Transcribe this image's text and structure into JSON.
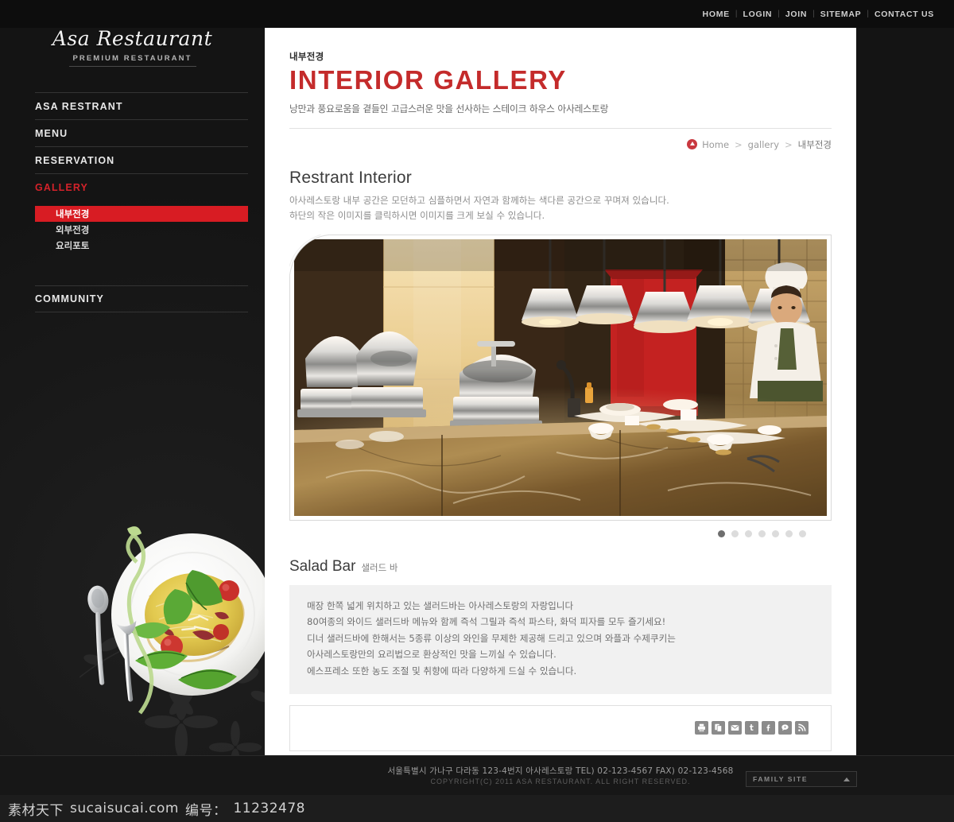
{
  "topnav": {
    "items": [
      {
        "label": "HOME"
      },
      {
        "label": "LOGIN"
      },
      {
        "label": "JOIN"
      },
      {
        "label": "SITEMAP"
      },
      {
        "label": "CONTACT US"
      }
    ],
    "separator": "|"
  },
  "logo": {
    "brand": "Asa Restaurant",
    "tagline": "PREMIUM  RESTAURANT"
  },
  "sidebar": {
    "items": [
      {
        "label": "ASA RESTRANT",
        "active": false
      },
      {
        "label": "MENU",
        "active": false
      },
      {
        "label": "RESERVATION",
        "active": false
      },
      {
        "label": "GALLERY",
        "active": true
      }
    ],
    "submenu": [
      {
        "label": "내부전경",
        "selected": true
      },
      {
        "label": "외부전경",
        "selected": false
      },
      {
        "label": "요리포토",
        "selected": false
      }
    ],
    "community": "COMMUNITY"
  },
  "page": {
    "eyebrow": "내부전경",
    "title": "INTERIOR GALLERY",
    "subtitle": "낭만과 풍요로움을 곁들인 고급스러운 맛을 선사하는 스테이크 하우스 아사레스토랑"
  },
  "breadcrumb": {
    "home": "Home",
    "sep1": ">",
    "section": "gallery",
    "sep2": ">",
    "current": "내부전경"
  },
  "section": {
    "heading": "Restrant Interior",
    "desc_line1": "아사레스토랑 내부 공간은 모던하고 심플하면서 자연과 함께하는 색다른 공간으로 꾸며져 있습니다.",
    "desc_line2": "하단의 작은 이미지를 클릭하시면 이미지를 크게 보실 수 있습니다."
  },
  "gallery": {
    "slide_count": 7,
    "active_slide": 1,
    "alt": "restaurant-interior-buffet-counter"
  },
  "salad": {
    "heading_en": "Salad Bar",
    "heading_ko": "샐러드 바",
    "lines": [
      "매장 한쪽 넓게 위치하고 있는 샐러드바는 아사레스토랑의 자랑입니다",
      "80여종의 와이드 샐러드바 메뉴와 함께 즉석 그릴과 즉석 파스타, 화덕 피자를 모두 즐기세요!",
      "디너 샐러드바에 한해서는 5종류 이상의 와인을 무제한 제공해 드리고 있으며 와플과 수제쿠키는",
      "아사레스토랑만의 요리법으로 환상적인 맛을 느끼실 수 있습니다.",
      "에스프레소 또한 농도 조절 및 취향에 따라 다양하게 드실 수 있습니다."
    ]
  },
  "share": {
    "icons": [
      {
        "name": "print-icon",
        "title": "Print"
      },
      {
        "name": "scrap-icon",
        "title": "Scrap"
      },
      {
        "name": "email-icon",
        "title": "Email"
      },
      {
        "name": "twitter-icon",
        "title": "Twitter"
      },
      {
        "name": "facebook-icon",
        "title": "Facebook"
      },
      {
        "name": "me2day-icon",
        "title": "me2day"
      },
      {
        "name": "rss-icon",
        "title": "RSS"
      }
    ]
  },
  "footer": {
    "address": "서울특별시 가나구 다라동 123-4번지 아사레스토랑    TEL) 02-123-4567  FAX) 02-123-4568",
    "copyright": "COPYRIGHT(C) 2011 ASA RESTAURANT.   ALL RIGHT RESERVED.",
    "family_site": "FAMILY SITE"
  },
  "watermark": {
    "brand": "素材天下",
    "site": "sucaisucai.com",
    "label": "编号：",
    "number": "11232478"
  },
  "colors": {
    "accent_red": "#d81c23",
    "title_red": "#c42b2b",
    "bg_dark": "#141414",
    "panel_white": "#ffffff",
    "salad_box": "#f1f1f1"
  }
}
